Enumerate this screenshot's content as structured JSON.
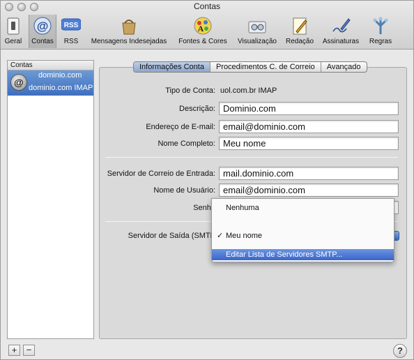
{
  "window": {
    "title": "Contas"
  },
  "toolbar": {
    "items": [
      {
        "label": "Geral",
        "icon": "light-switch-icon"
      },
      {
        "label": "Contas",
        "icon": "at-sign-icon",
        "active": true
      },
      {
        "label": "RSS",
        "icon": "rss-icon"
      },
      {
        "label": "Mensagens Indesejadas",
        "icon": "junk-bag-icon"
      },
      {
        "label": "Fontes & Cores",
        "icon": "font-palette-icon"
      },
      {
        "label": "Visualização",
        "icon": "glasses-icon"
      },
      {
        "label": "Redação",
        "icon": "pencil-notepad-icon"
      },
      {
        "label": "Assinaturas",
        "icon": "signature-pen-icon"
      },
      {
        "label": "Regras",
        "icon": "rules-icon"
      }
    ]
  },
  "accounts": {
    "header": "Contas",
    "selected": {
      "name": "dominio.com",
      "detail": "dominio.com IMAP"
    },
    "add_label": "+",
    "remove_label": "−"
  },
  "tabs": {
    "items": [
      "Informações Conta",
      "Procedimentos C. de Correio",
      "Avançado"
    ],
    "active": "Informações Conta"
  },
  "form": {
    "account_type_label": "Tipo de Conta:",
    "account_type_value": "uol.com.br IMAP",
    "description_label": "Descrição:",
    "description_value": "Dominio.com",
    "email_label": "Endereço de E-mail:",
    "email_value": "email@dominio.com",
    "fullname_label": "Nome Completo:",
    "fullname_value": "Meu nome",
    "incoming_label": "Servidor de Correio de Entrada:",
    "incoming_value": "mail.dominio.com",
    "username_label": "Nome de Usuário:",
    "username_value": "email@dominio.com",
    "password_label": "Senha",
    "smtp_label": "Servidor de Saída (SMTP"
  },
  "smtp_menu": {
    "items": [
      "Nenhuma",
      "Meu nome",
      "Editar Lista de Servidores SMTP..."
    ],
    "checked": "Meu nome",
    "check_mark": "✓",
    "highlighted": "Editar Lista de Servidores SMTP..."
  },
  "help": {
    "label": "?"
  },
  "colors": {
    "selection": "#3e6fbe",
    "menu_highlight": "#3a66c9",
    "window_bg": "#e8e8e8"
  }
}
